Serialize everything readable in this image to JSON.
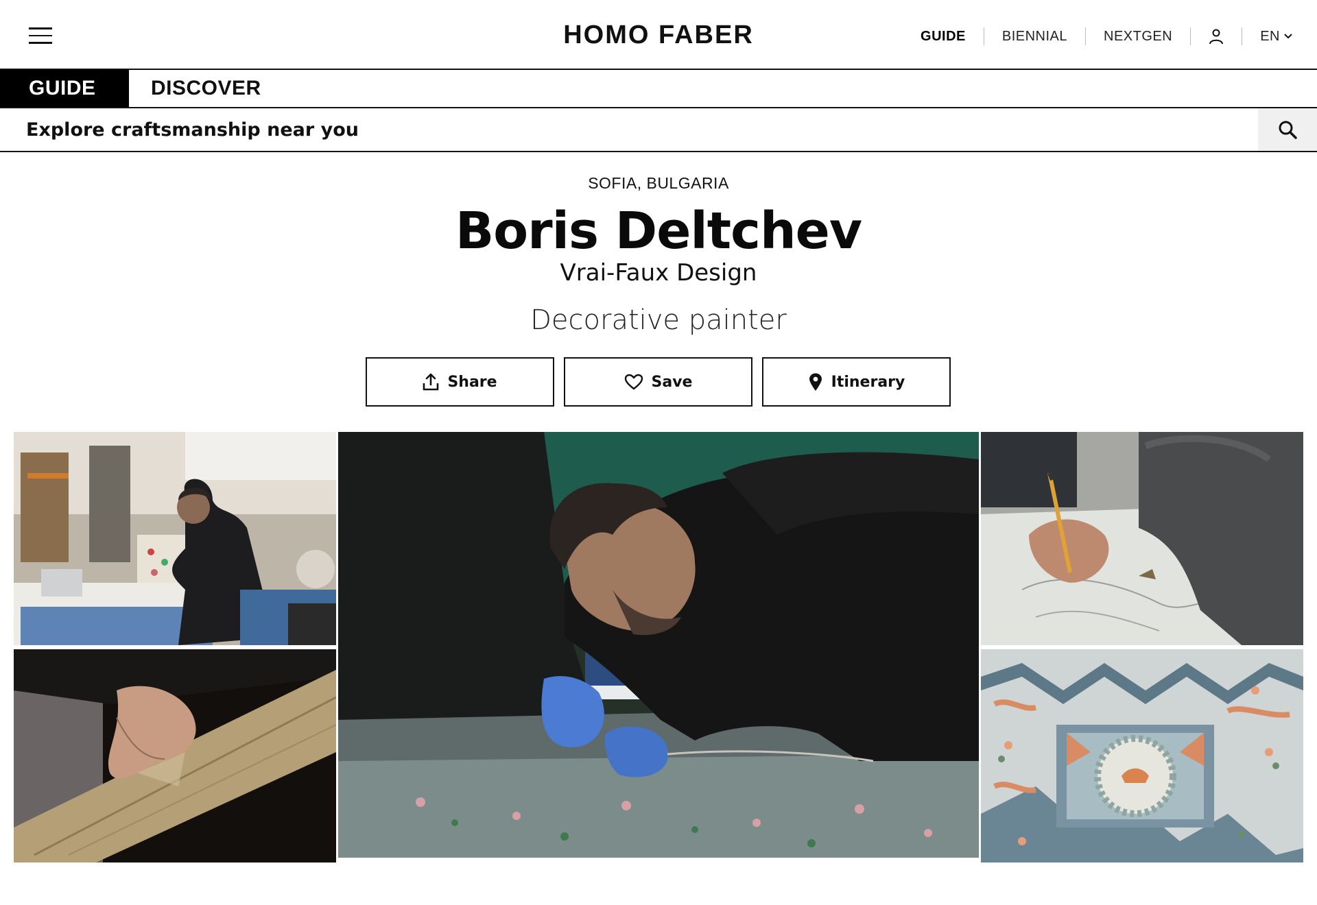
{
  "header": {
    "brand": "HOMO FABER",
    "nav": [
      {
        "label": "GUIDE",
        "active": true
      },
      {
        "label": "BIENNIAL",
        "active": false
      },
      {
        "label": "NEXTGEN",
        "active": false
      }
    ],
    "language": "EN",
    "icons": {
      "menu": "hamburger-icon",
      "account": "user-icon",
      "language": "chevron-down-icon"
    }
  },
  "tabs": [
    {
      "label": "GUIDE",
      "active": true
    },
    {
      "label": "DISCOVER",
      "active": false
    }
  ],
  "search": {
    "placeholder": "Explore craftsmanship near you",
    "icon": "search-icon"
  },
  "profile": {
    "location": "SOFIA, BULGARIA",
    "name": "Boris Deltchev",
    "studio": "Vrai-Faux Design",
    "craft": "Decorative painter"
  },
  "actions": [
    {
      "label": "Share",
      "icon": "share-icon"
    },
    {
      "label": "Save",
      "icon": "heart-icon"
    },
    {
      "label": "Itinerary",
      "icon": "map-pin-icon"
    }
  ],
  "gallery": {
    "photos": [
      {
        "name": "photo-workshop"
      },
      {
        "name": "photo-paper-roll"
      },
      {
        "name": "photo-painter-on-floor"
      },
      {
        "name": "photo-pencil-drawing"
      },
      {
        "name": "photo-ornamental-panel"
      }
    ]
  },
  "colors": {
    "text": "#111111",
    "accent": "#000000",
    "background": "#ffffff",
    "search_button_bg": "#f0f0f0"
  }
}
